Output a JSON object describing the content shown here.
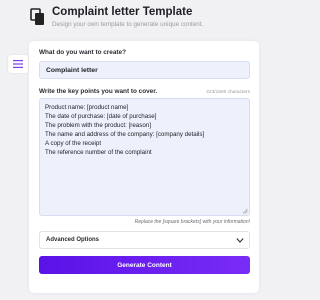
{
  "header": {
    "title": "Complaint letter Template",
    "subtitle": "Design your own template to generate unique content.",
    "icon": "copy-icon"
  },
  "sidebar": {
    "menu_icon": "menu-lines-icon"
  },
  "form": {
    "type_label": "What do you want to create?",
    "type_value": "Complaint letter",
    "points_label": "Write the key points you want to cover.",
    "char_count": "223/1500 characters",
    "points_lines": [
      "Product name: [product name]",
      "The date of purchase: [date of purchase]",
      "The problem with the product: [reason]",
      "The name and address of the company: [company details]",
      "A copy of the receipt",
      "The reference number of the complaint"
    ],
    "hint": "Replace the [square brackets] with your information!",
    "advanced_label": "Advanced Options",
    "generate_label": "Generate Content"
  },
  "colors": {
    "accent_start": "#5a12e8",
    "accent_end": "#7a2cf6",
    "input_bg": "#eef1fb",
    "page_bg": "#f1f1f4"
  }
}
